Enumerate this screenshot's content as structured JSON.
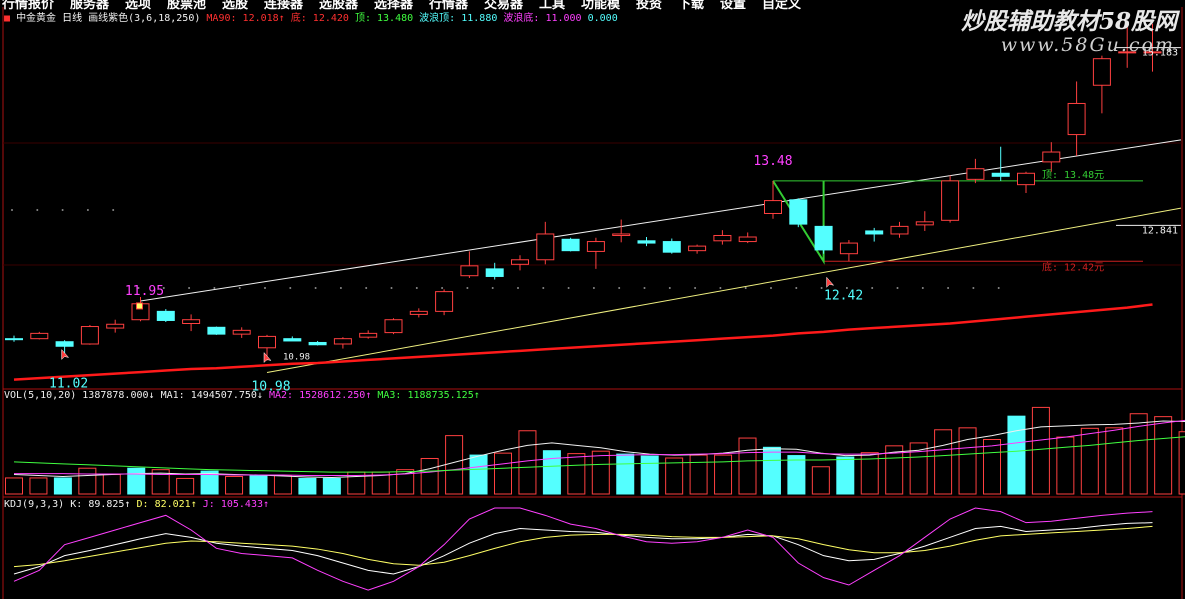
{
  "menu": [
    "行情报价",
    "服务器",
    "选项",
    "股票池",
    "选股",
    "连接器",
    "选股器",
    "选择器",
    "行情器",
    "交易器",
    "工具",
    "功能模",
    "投资",
    "下载",
    "设置",
    "自定义"
  ],
  "header": {
    "stock_name": "中金黄金",
    "period": "日线",
    "indicator": "画线紫色(3,6,18,250)",
    "ma90_label": "MA90:",
    "ma90_value": "12.018↑",
    "bottom_label": "底:",
    "bottom_value": "12.420",
    "top_label": "顶:",
    "top_value": "13.480",
    "wave_top_label": "波浪顶:",
    "wave_top_value": "11.880",
    "wave_bottom_label": "波浪底:",
    "wave_bottom_value": "11.000",
    "extra_value": "0.000"
  },
  "watermark": {
    "title": "炒股辅助教材58股网",
    "url": "www.58Gu.com"
  },
  "colors": {
    "up": "#ff4040",
    "down": "#54ffff",
    "ma90": "#ff1a1a",
    "channel_upper": "#f0f0f0",
    "channel_lower": "#f0f080",
    "top_line": "#33cc33",
    "bottom_line": "#cc2020",
    "magenta": "#ff40ff",
    "k_line": "#ffffff",
    "d_line": "#ffff66"
  },
  "chart_data": [
    {
      "type": "candlestick",
      "title": "中金黄金 日线",
      "price_axis_labels": [
        "15.183",
        "12.841"
      ],
      "annotations": [
        {
          "text": "11.95",
          "value": 11.95,
          "kind": "high"
        },
        {
          "text": "11.02",
          "value": 11.02,
          "kind": "low"
        },
        {
          "text": "10.98",
          "value": 10.98,
          "kind": "low"
        },
        {
          "text": "10.98",
          "value": 10.98,
          "kind": "low-marker"
        },
        {
          "text": "13.48",
          "value": 13.48,
          "kind": "high"
        },
        {
          "text": "12.42",
          "value": 12.42,
          "kind": "low"
        },
        {
          "text": "顶: 13.48元",
          "value": 13.48,
          "kind": "top-line"
        },
        {
          "text": "底: 12.42元",
          "value": 12.42,
          "kind": "bottom-line"
        }
      ],
      "ylim": [
        10.75,
        15.6
      ],
      "candles": [
        {
          "o": 11.4,
          "h": 11.44,
          "l": 11.36,
          "c": 11.4,
          "dir": "down"
        },
        {
          "o": 11.4,
          "h": 11.49,
          "l": 11.39,
          "c": 11.47,
          "dir": "up"
        },
        {
          "o": 11.36,
          "h": 11.38,
          "l": 11.2,
          "c": 11.3,
          "dir": "down"
        },
        {
          "o": 11.33,
          "h": 11.58,
          "l": 11.32,
          "c": 11.56,
          "dir": "up"
        },
        {
          "o": 11.54,
          "h": 11.65,
          "l": 11.48,
          "c": 11.59,
          "dir": "up"
        },
        {
          "o": 11.65,
          "h": 11.95,
          "l": 11.63,
          "c": 11.86,
          "dir": "up"
        },
        {
          "o": 11.76,
          "h": 11.79,
          "l": 11.62,
          "c": 11.64,
          "dir": "down"
        },
        {
          "o": 11.6,
          "h": 11.72,
          "l": 11.5,
          "c": 11.65,
          "dir": "up"
        },
        {
          "o": 11.55,
          "h": 11.56,
          "l": 11.45,
          "c": 11.46,
          "dir": "down"
        },
        {
          "o": 11.46,
          "h": 11.55,
          "l": 11.41,
          "c": 11.51,
          "dir": "up"
        },
        {
          "o": 11.28,
          "h": 11.45,
          "l": 11.11,
          "c": 11.43,
          "dir": "up"
        },
        {
          "o": 11.4,
          "h": 11.43,
          "l": 11.37,
          "c": 11.37,
          "dir": "down"
        },
        {
          "o": 11.35,
          "h": 11.37,
          "l": 11.31,
          "c": 11.32,
          "dir": "down"
        },
        {
          "o": 11.33,
          "h": 11.42,
          "l": 11.27,
          "c": 11.4,
          "dir": "up"
        },
        {
          "o": 11.42,
          "h": 11.51,
          "l": 11.4,
          "c": 11.47,
          "dir": "up"
        },
        {
          "o": 11.48,
          "h": 11.67,
          "l": 11.46,
          "c": 11.65,
          "dir": "up"
        },
        {
          "o": 11.72,
          "h": 11.8,
          "l": 11.68,
          "c": 11.76,
          "dir": "up"
        },
        {
          "o": 11.76,
          "h": 12.05,
          "l": 11.71,
          "c": 12.02,
          "dir": "up"
        },
        {
          "o": 12.23,
          "h": 12.55,
          "l": 12.2,
          "c": 12.36,
          "dir": "up"
        },
        {
          "o": 12.32,
          "h": 12.4,
          "l": 12.18,
          "c": 12.22,
          "dir": "down"
        },
        {
          "o": 12.38,
          "h": 12.5,
          "l": 12.3,
          "c": 12.44,
          "dir": "up"
        },
        {
          "o": 12.44,
          "h": 12.94,
          "l": 12.38,
          "c": 12.78,
          "dir": "up"
        },
        {
          "o": 12.71,
          "h": 12.73,
          "l": 12.55,
          "c": 12.56,
          "dir": "down"
        },
        {
          "o": 12.55,
          "h": 12.73,
          "l": 12.32,
          "c": 12.68,
          "dir": "up"
        },
        {
          "o": 12.76,
          "h": 12.97,
          "l": 12.67,
          "c": 12.78,
          "dir": "up"
        },
        {
          "o": 12.69,
          "h": 12.74,
          "l": 12.62,
          "c": 12.66,
          "dir": "down"
        },
        {
          "o": 12.68,
          "h": 12.72,
          "l": 12.52,
          "c": 12.54,
          "dir": "down"
        },
        {
          "o": 12.56,
          "h": 12.64,
          "l": 12.52,
          "c": 12.62,
          "dir": "up"
        },
        {
          "o": 12.69,
          "h": 12.83,
          "l": 12.64,
          "c": 12.76,
          "dir": "up"
        },
        {
          "o": 12.68,
          "h": 12.8,
          "l": 12.66,
          "c": 12.74,
          "dir": "up"
        },
        {
          "o": 13.05,
          "h": 13.48,
          "l": 12.98,
          "c": 13.22,
          "dir": "up"
        },
        {
          "o": 13.23,
          "h": 13.25,
          "l": 12.87,
          "c": 12.91,
          "dir": "down"
        },
        {
          "o": 12.88,
          "h": 12.89,
          "l": 12.52,
          "c": 12.57,
          "dir": "down"
        },
        {
          "o": 12.52,
          "h": 12.7,
          "l": 12.42,
          "c": 12.66,
          "dir": "up"
        },
        {
          "o": 12.82,
          "h": 12.86,
          "l": 12.68,
          "c": 12.78,
          "dir": "down"
        },
        {
          "o": 12.78,
          "h": 12.94,
          "l": 12.73,
          "c": 12.88,
          "dir": "up"
        },
        {
          "o": 12.9,
          "h": 13.08,
          "l": 12.82,
          "c": 12.94,
          "dir": "up"
        },
        {
          "o": 12.96,
          "h": 13.55,
          "l": 12.93,
          "c": 13.48,
          "dir": "up"
        },
        {
          "o": 13.5,
          "h": 13.77,
          "l": 13.45,
          "c": 13.64,
          "dir": "up"
        },
        {
          "o": 13.58,
          "h": 13.93,
          "l": 13.48,
          "c": 13.54,
          "dir": "down"
        },
        {
          "o": 13.43,
          "h": 13.6,
          "l": 13.32,
          "c": 13.58,
          "dir": "up"
        },
        {
          "o": 13.73,
          "h": 13.99,
          "l": 13.6,
          "c": 13.86,
          "dir": "up"
        },
        {
          "o": 14.09,
          "h": 14.79,
          "l": 13.81,
          "c": 14.5,
          "dir": "up"
        },
        {
          "o": 14.74,
          "h": 15.13,
          "l": 14.37,
          "c": 15.09,
          "dir": "up"
        },
        {
          "o": 15.18,
          "h": 15.55,
          "l": 14.97,
          "c": 15.18,
          "dir": "up"
        },
        {
          "o": 15.18,
          "h": 15.55,
          "l": 14.92,
          "c": 15.18,
          "dir": "up"
        }
      ],
      "ma90": [
        10.86,
        10.88,
        10.9,
        10.92,
        10.94,
        10.96,
        10.98,
        11.0,
        11.01,
        11.03,
        11.05,
        11.07,
        11.08,
        11.1,
        11.12,
        11.14,
        11.16,
        11.18,
        11.2,
        11.22,
        11.24,
        11.26,
        11.28,
        11.3,
        11.32,
        11.34,
        11.36,
        11.38,
        11.4,
        11.42,
        11.44,
        11.47,
        11.49,
        11.52,
        11.54,
        11.56,
        11.58,
        11.6,
        11.63,
        11.66,
        11.69,
        11.72,
        11.75,
        11.78,
        11.81,
        11.85
      ]
    },
    {
      "type": "bar",
      "title": "VOL(5,10,20)",
      "legend": [
        {
          "name": "VOL(5,10,20)",
          "value": "1387878.000↓"
        },
        {
          "name": "MA1:",
          "value": "1494507.750↓"
        },
        {
          "name": "MA2:",
          "value": "1528612.250↑"
        },
        {
          "name": "MA3:",
          "value": "1188735.125↑"
        }
      ],
      "ylim": [
        0,
        1850000
      ],
      "values": [
        330000,
        330000,
        330000,
        530000,
        400000,
        530000,
        500000,
        320000,
        470000,
        360000,
        380000,
        380000,
        320000,
        320000,
        450000,
        450000,
        500000,
        730000,
        1200000,
        800000,
        840000,
        1300000,
        890000,
        830000,
        880000,
        820000,
        780000,
        740000,
        800000,
        800000,
        1150000,
        960000,
        790000,
        560000,
        760000,
        850000,
        990000,
        1050000,
        1320000,
        1360000,
        1120000,
        1600000,
        1780000,
        1170000,
        1350000,
        1360000,
        1650000,
        1590000,
        1280000
      ],
      "colors": [
        "up",
        "up",
        "down",
        "up",
        "up",
        "down",
        "up",
        "up",
        "down",
        "up",
        "down",
        "up",
        "down",
        "down",
        "up",
        "up",
        "up",
        "up",
        "up",
        "down",
        "up",
        "up",
        "down",
        "up",
        "up",
        "down",
        "down",
        "up",
        "up",
        "up",
        "up",
        "down",
        "down",
        "up",
        "down",
        "up",
        "up",
        "up",
        "up",
        "up",
        "up",
        "down",
        "up",
        "up",
        "up",
        "up",
        "up",
        "up",
        "up"
      ],
      "ma1": [
        400000,
        380000,
        360000,
        380000,
        400000,
        420000,
        430000,
        410000,
        420000,
        400000,
        390000,
        370000,
        350000,
        340000,
        360000,
        380000,
        420000,
        520000,
        650000,
        780000,
        900000,
        1000000,
        1050000,
        1000000,
        950000,
        870000,
        820000,
        800000,
        810000,
        840000,
        900000,
        930000,
        920000,
        840000,
        790000,
        800000,
        860000,
        900000,
        1000000,
        1120000,
        1200000,
        1300000,
        1380000,
        1400000,
        1420000,
        1430000,
        1460000,
        1500000,
        1490000
      ],
      "ma2": [
        420000,
        420000,
        420000,
        410000,
        410000,
        410000,
        400000,
        400000,
        400000,
        390000,
        390000,
        390000,
        380000,
        380000,
        380000,
        390000,
        410000,
        450000,
        500000,
        560000,
        620000,
        680000,
        730000,
        760000,
        790000,
        800000,
        810000,
        810000,
        820000,
        830000,
        850000,
        860000,
        860000,
        830000,
        820000,
        820000,
        840000,
        870000,
        910000,
        950000,
        990000,
        1050000,
        1110000,
        1170000,
        1240000,
        1310000,
        1390000,
        1460000,
        1520000
      ],
      "ma3": [
        660000,
        640000,
        620000,
        600000,
        580000,
        560000,
        540000,
        520000,
        500000,
        490000,
        480000,
        470000,
        460000,
        450000,
        450000,
        450000,
        460000,
        470000,
        490000,
        510000,
        530000,
        550000,
        570000,
        590000,
        610000,
        620000,
        630000,
        640000,
        650000,
        660000,
        680000,
        690000,
        700000,
        700000,
        710000,
        720000,
        740000,
        760000,
        790000,
        820000,
        850000,
        880000,
        920000,
        960000,
        1000000,
        1050000,
        1100000,
        1140000,
        1180000
      ]
    },
    {
      "type": "line",
      "title": "KDJ(9,3,3)",
      "legend": [
        {
          "name": "KDJ(9,3,3) K:",
          "value": "89.825↑"
        },
        {
          "name": "D:",
          "value": "82.021↑"
        },
        {
          "name": "J:",
          "value": "105.433↑"
        }
      ],
      "ylim": [
        -10,
        110
      ],
      "series": [
        {
          "name": "K",
          "color": "k_line",
          "values": [
            20,
            30,
            45,
            52,
            60,
            68,
            75,
            70,
            62,
            58,
            55,
            52,
            45,
            35,
            25,
            20,
            30,
            45,
            62,
            75,
            82,
            80,
            78,
            77,
            73,
            70,
            68,
            68,
            70,
            74,
            72,
            60,
            45,
            38,
            40,
            48,
            58,
            70,
            82,
            85,
            78,
            80,
            82,
            86,
            89,
            90
          ]
        },
        {
          "name": "D",
          "color": "d_line",
          "values": [
            30,
            33,
            38,
            44,
            50,
            56,
            62,
            65,
            64,
            62,
            60,
            58,
            54,
            48,
            40,
            34,
            32,
            36,
            45,
            55,
            64,
            70,
            73,
            74,
            74,
            73,
            71,
            70,
            70,
            71,
            72,
            68,
            60,
            53,
            49,
            49,
            52,
            58,
            66,
            72,
            74,
            76,
            78,
            80,
            82,
            85
          ]
        },
        {
          "name": "J",
          "color": "magenta",
          "values": [
            10,
            25,
            60,
            70,
            80,
            90,
            100,
            80,
            55,
            48,
            45,
            42,
            25,
            10,
            -2,
            10,
            30,
            60,
            95,
            110,
            110,
            100,
            88,
            82,
            72,
            64,
            62,
            64,
            70,
            80,
            70,
            35,
            15,
            5,
            25,
            45,
            70,
            95,
            110,
            105,
            90,
            92,
            96,
            100,
            103,
            105
          ]
        }
      ]
    }
  ]
}
